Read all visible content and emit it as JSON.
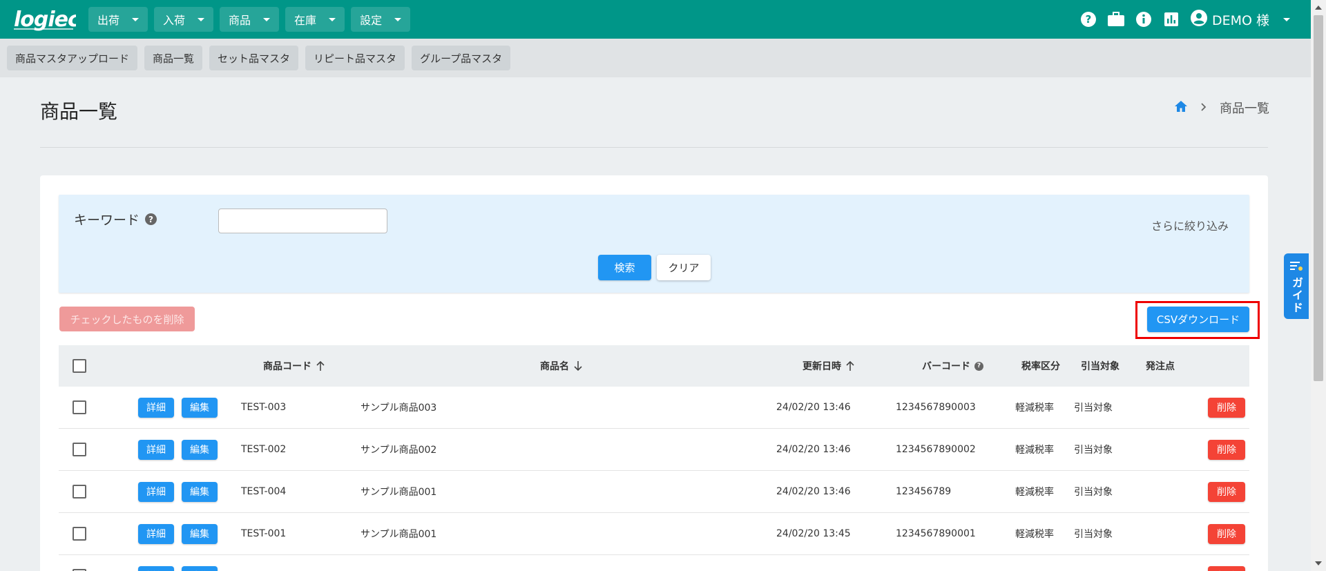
{
  "header": {
    "logo_text": "logiec",
    "nav": [
      {
        "label": "出荷"
      },
      {
        "label": "入荷"
      },
      {
        "label": "商品"
      },
      {
        "label": "在庫"
      },
      {
        "label": "設定"
      }
    ],
    "icons": [
      "help-icon",
      "briefcase-icon",
      "info-icon",
      "bar-chart-icon",
      "account-icon"
    ],
    "user_label": "DEMO 様"
  },
  "subnav": {
    "items": [
      {
        "label": "商品マスタアップロード"
      },
      {
        "label": "商品一覧"
      },
      {
        "label": "セット品マスタ"
      },
      {
        "label": "リピート品マスタ"
      },
      {
        "label": "グループ品マスタ"
      }
    ]
  },
  "page": {
    "title": "商品一覧",
    "breadcrumb": {
      "current": "商品一覧"
    }
  },
  "search": {
    "keyword_label": "キーワード",
    "keyword_value": "",
    "refine_label": "さらに絞り込み",
    "search_button": "検索",
    "clear_button": "クリア"
  },
  "actions": {
    "delete_checked": "チェックしたものを削除",
    "csv_download": "CSVダウンロード"
  },
  "table": {
    "headers": {
      "code": "商品コード",
      "name": "商品名",
      "updated": "更新日時",
      "barcode": "バーコード",
      "tax": "税率区分",
      "allocation": "引当対象",
      "reorder": "発注点"
    },
    "detail_label": "詳細",
    "edit_label": "編集",
    "delete_label": "削除",
    "rows": [
      {
        "code": "TEST-003",
        "name": "サンプル商品003",
        "updated": "24/02/20 13:46",
        "barcode": "1234567890003",
        "tax": "軽減税率",
        "allocation": "引当対象",
        "reorder": ""
      },
      {
        "code": "TEST-002",
        "name": "サンプル商品002",
        "updated": "24/02/20 13:46",
        "barcode": "1234567890002",
        "tax": "軽減税率",
        "allocation": "引当対象",
        "reorder": ""
      },
      {
        "code": "TEST-004",
        "name": "サンプル商品001",
        "updated": "24/02/20 13:46",
        "barcode": "123456789",
        "tax": "軽減税率",
        "allocation": "引当対象",
        "reorder": ""
      },
      {
        "code": "TEST-001",
        "name": "サンプル商品001",
        "updated": "24/02/20 13:45",
        "barcode": "1234567890001",
        "tax": "軽減税率",
        "allocation": "引当対象",
        "reorder": ""
      }
    ]
  },
  "guide": {
    "label": "ガイド"
  },
  "colors": {
    "header": "#009688",
    "primary": "#2196f3",
    "danger": "#f44336",
    "highlight": "#e00000"
  }
}
